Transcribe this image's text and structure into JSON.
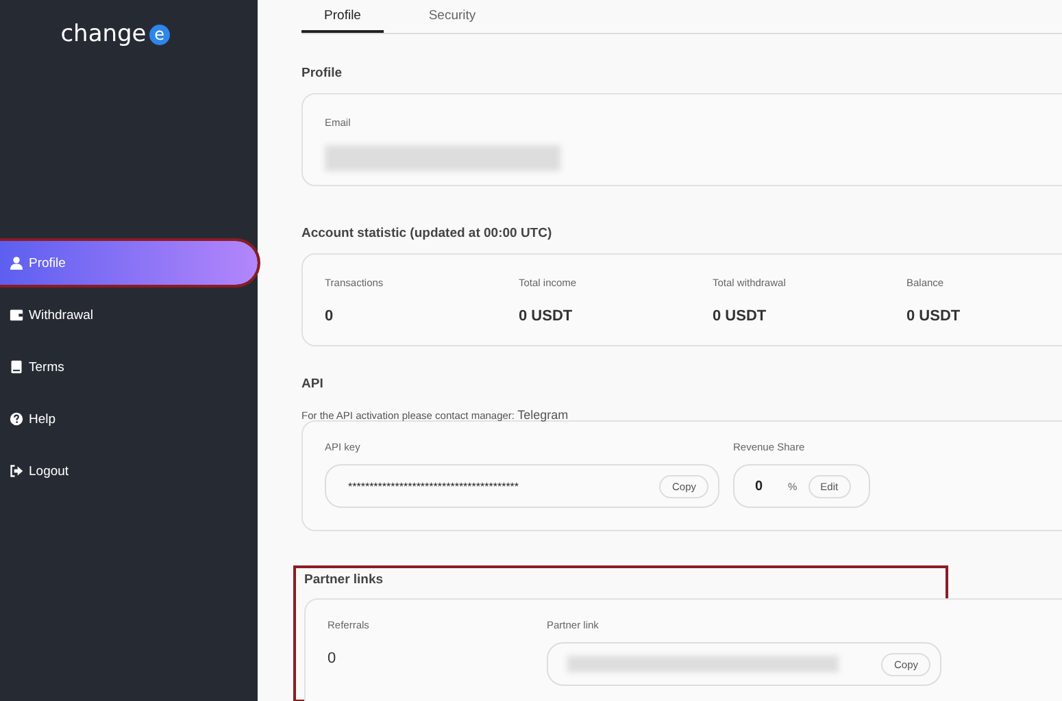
{
  "logo": {
    "text": "change",
    "badge": "e"
  },
  "nav": [
    {
      "label": "Profile",
      "kind": "user",
      "selected": true,
      "highlighted": true
    },
    {
      "label": "Withdrawal",
      "kind": "wallet",
      "selected": false,
      "highlighted": false
    },
    {
      "label": "Terms",
      "kind": "book",
      "selected": false,
      "highlighted": false
    },
    {
      "label": "Help",
      "kind": "question",
      "selected": false,
      "highlighted": false
    },
    {
      "label": "Logout",
      "kind": "logout",
      "selected": false,
      "highlighted": false
    }
  ],
  "tabs": [
    {
      "label": "Profile",
      "selected": true
    },
    {
      "label": "Security",
      "selected": false
    }
  ],
  "profile": {
    "title": "Profile",
    "email_label": "Email",
    "email_redacted": true
  },
  "stats": {
    "title": "Account statistic (updated at 00:00 UTC)",
    "items": [
      {
        "label": "Transactions",
        "value": "0"
      },
      {
        "label": "Total income",
        "value": "0 USDT"
      },
      {
        "label": "Total withdrawal",
        "value": "0 USDT"
      },
      {
        "label": "Balance",
        "value": "0 USDT"
      }
    ]
  },
  "api": {
    "title": "API",
    "note": "For the API activation please contact manager:",
    "note_link": "Telegram",
    "key_label": "API key",
    "key_value": "****************************************",
    "copy_button": "Copy",
    "share_label": "Revenue Share",
    "share_value": "0",
    "share_unit": "%",
    "edit_button": "Edit"
  },
  "partner": {
    "title": "Partner links",
    "highlighted": true,
    "referrals_label": "Referrals",
    "referrals_value": "0",
    "link_label": "Partner link",
    "link_redacted": true,
    "copy_button": "Copy"
  }
}
